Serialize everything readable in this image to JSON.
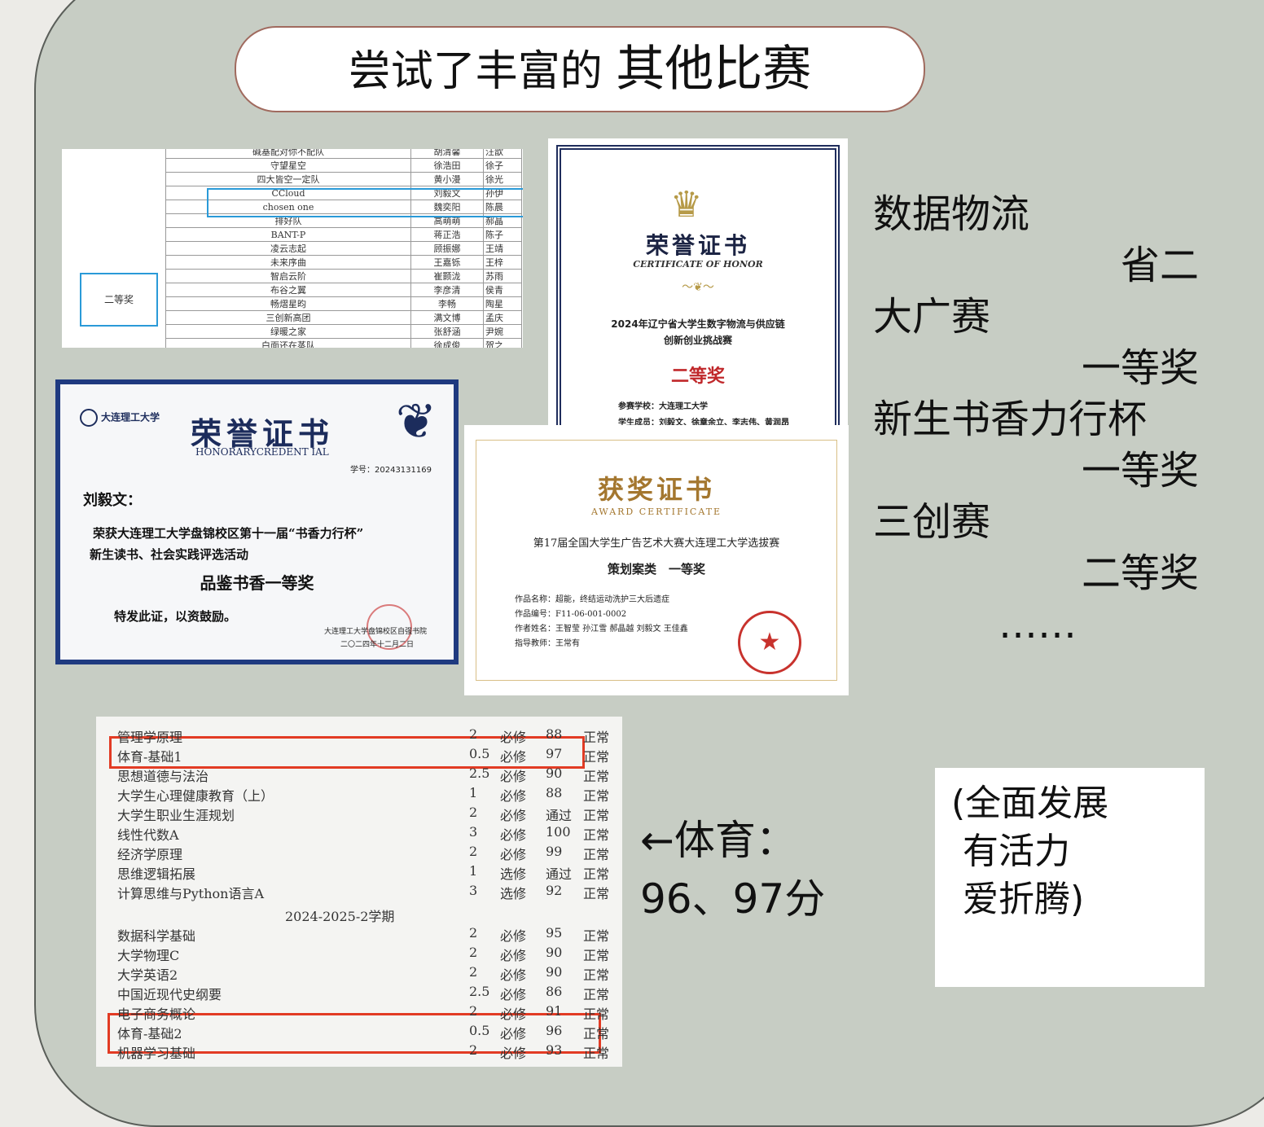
{
  "title": {
    "part1": "尝试了丰富的",
    "part2": "其他比赛"
  },
  "team_table": {
    "rows": [
      [
        "碱基配对你不配队",
        "胡清馨",
        "汪歆"
      ],
      [
        "守望星空",
        "徐浩田",
        "徐子"
      ],
      [
        "四大皆空一定队",
        "黄小漫",
        "徐光"
      ],
      [
        "CCloud",
        "刘毅文",
        "孙伊"
      ],
      [
        "chosen one",
        "魏奕阳",
        "陈晨"
      ],
      [
        "排好队",
        "高萌萌",
        "郝晶"
      ],
      [
        "BANT-P",
        "蒋正浩",
        "陈子"
      ],
      [
        "凌云志起",
        "顾振娜",
        "王靖"
      ],
      [
        "未来序曲",
        "王嘉铄",
        "王梓"
      ],
      [
        "智启云阶",
        "崔颢泷",
        "苏雨"
      ],
      [
        "布谷之翼",
        "李彦清",
        "侯青"
      ],
      [
        "畅熠星昀",
        "李畅",
        "陶星"
      ],
      [
        "三创新高团",
        "满文博",
        "孟庆"
      ],
      [
        "绿暖之家",
        "张舒涵",
        "尹婉"
      ],
      [
        "白面还在蒸队",
        "徐成俊",
        "贺之"
      ]
    ],
    "award": "二等奖"
  },
  "cert_logistics": {
    "title": "荣誉证书",
    "subtitle": "CERTIFICATE OF HONOR",
    "event_line1": "2024年辽宁省大学生数字物流与供应链",
    "event_line2": "创新创业挑战赛",
    "prize": "二等奖",
    "school": "参赛学校：大连理工大学",
    "members": "学生成员：刘毅文、徐章余立、李志伟、黄润昂"
  },
  "cert_reading": {
    "logo": "大连理工大学",
    "title": "荣誉证书",
    "subtitle": "HONORARYCREDENT IAL",
    "number": "学号：20243131169",
    "name": "刘毅文：",
    "body_line1": "荣获大连理工大学盘锦校区第十一届“书香力行杯”",
    "body_line2": "新生读书、社会实践评选活动",
    "prize": "品鉴书香一等奖",
    "certify": "特发此证，以资鼓励。",
    "issuer": "大连理工大学盘锦校区自强书院",
    "date": "二〇二四年十二月二日"
  },
  "cert_ad": {
    "title": "获奖证书",
    "subtitle": "AWARD CERTIFICATE",
    "event": "第17届全国大学生广告艺术大赛大连理工大学选拔赛",
    "prize": "策划案类　一等奖",
    "work_name": "作品名称：超能，终结运动洗护三大后遗症",
    "work_no": "作品编号：F11-06-001-0002",
    "authors": "作者姓名：王智莹 孙江雪 郝晶越 刘毅文 王佳鑫",
    "advisor": "指导教师：王常有"
  },
  "grades": {
    "rows": [
      {
        "course": "管理学原理",
        "credit": "2",
        "type": "必修",
        "score": "88",
        "status": "正常"
      },
      {
        "course": "体育-基础1",
        "credit": "0.5",
        "type": "必修",
        "score": "97",
        "status": "正常"
      },
      {
        "course": "思想道德与法治",
        "credit": "2.5",
        "type": "必修",
        "score": "90",
        "status": "正常"
      },
      {
        "course": "大学生心理健康教育（上）",
        "credit": "1",
        "type": "必修",
        "score": "88",
        "status": "正常"
      },
      {
        "course": "大学生职业生涯规划",
        "credit": "2",
        "type": "必修",
        "score": "通过",
        "status": "正常"
      },
      {
        "course": "线性代数A",
        "credit": "3",
        "type": "必修",
        "score": "100",
        "status": "正常"
      },
      {
        "course": "经济学原理",
        "credit": "2",
        "type": "必修",
        "score": "99",
        "status": "正常"
      },
      {
        "course": "思维逻辑拓展",
        "credit": "1",
        "type": "选修",
        "score": "通过",
        "status": "正常"
      },
      {
        "course": "计算思维与Python语言A",
        "credit": "3",
        "type": "选修",
        "score": "92",
        "status": "正常"
      }
    ],
    "semester": "2024-2025-2学期",
    "rows2": [
      {
        "course": "数据科学基础",
        "credit": "2",
        "type": "必修",
        "score": "95",
        "status": "正常"
      },
      {
        "course": "大学物理C",
        "credit": "2",
        "type": "必修",
        "score": "90",
        "status": "正常"
      },
      {
        "course": "大学英语2",
        "credit": "2",
        "type": "必修",
        "score": "90",
        "status": "正常"
      },
      {
        "course": "中国近现代史纲要",
        "credit": "2.5",
        "type": "必修",
        "score": "86",
        "status": "正常"
      },
      {
        "course": "电子商务概论",
        "credit": "2",
        "type": "必修",
        "score": "91",
        "status": "正常"
      },
      {
        "course": "体育-基础2",
        "credit": "0.5",
        "type": "必修",
        "score": "96",
        "status": "正常"
      },
      {
        "course": "机器学习基础",
        "credit": "2",
        "type": "必修",
        "score": "93",
        "status": "正常"
      }
    ]
  },
  "awards_list": [
    {
      "name": "数据物流",
      "level": "省二"
    },
    {
      "name": "大广赛",
      "level": "一等奖"
    },
    {
      "name": "新生书香力行杯",
      "level": "一等奖"
    },
    {
      "name": "三创赛",
      "level": "二等奖"
    }
  ],
  "awards_more": "……",
  "sports": {
    "line1": "←体育：",
    "line2": "96、97分"
  },
  "note": {
    "line1": "(全面发展",
    "line2": " 有活力",
    "line3": " 爱折腾)"
  }
}
